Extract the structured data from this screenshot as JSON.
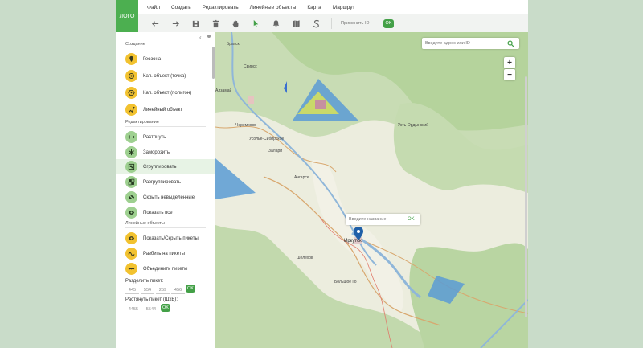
{
  "app": {
    "logo": "ЛОГО"
  },
  "menu": [
    "Файл",
    "Создать",
    "Редактировать",
    "Линейные объекты",
    "Карта",
    "Маршрут"
  ],
  "toolbar": {
    "icons": [
      "arrow-left-icon",
      "arrow-right-icon",
      "save-icon",
      "trash-icon",
      "hand-icon",
      "cursor-icon",
      "bell-icon",
      "map-icon",
      "s-curve-icon"
    ],
    "apply_placeholder": "Применить ID",
    "ok_label": "OK"
  },
  "sidebar": {
    "section_create": "Создание",
    "create_items": [
      {
        "label": "Геозона",
        "icon": "pin-icon"
      },
      {
        "label": "Кап. объект (точка)",
        "icon": "point-object-icon"
      },
      {
        "label": "Кап. объект (полигон)",
        "icon": "polygon-object-icon"
      },
      {
        "label": "Линейный объект",
        "icon": "line-object-icon"
      }
    ],
    "section_edit": "Редактирование",
    "edit_items": [
      {
        "label": "Растянуть",
        "icon": "stretch-icon"
      },
      {
        "label": "Заморозить",
        "icon": "snowflake-icon"
      },
      {
        "label": "Сгруппировать",
        "icon": "group-icon"
      },
      {
        "label": "Разгруппировать",
        "icon": "ungroup-icon"
      },
      {
        "label": "Скрыть невыделенные",
        "icon": "eye-off-icon"
      },
      {
        "label": "Показать все",
        "icon": "eye-icon"
      }
    ],
    "section_linear": "Линейные объекты",
    "linear_items": [
      {
        "label": "Показать/Скрыть пикеты",
        "icon": "eye-pickets-icon"
      },
      {
        "label": "Разбить на пикеты",
        "icon": "split-pickets-icon"
      },
      {
        "label": "Объединить пикеты",
        "icon": "merge-pickets-icon"
      }
    ],
    "split_label": "Разделить пикет:",
    "split_values": [
      "445",
      "554",
      "259",
      "456"
    ],
    "stretch_label": "Растянуть пикет (ШхВ):",
    "stretch_values": [
      "4455",
      "5544"
    ],
    "ok_label": "OK"
  },
  "map": {
    "search_placeholder": "Введите адрес или ID",
    "zoom_in": "+",
    "zoom_out": "−",
    "name_placeholder": "Введите название",
    "name_ok": "OK",
    "cities": [
      {
        "name": "Братск",
        "big": false
      },
      {
        "name": "Усть-Ордынский",
        "big": false
      },
      {
        "name": "Свирск",
        "big": false
      },
      {
        "name": "Черемхово",
        "big": false
      },
      {
        "name": "Ангарск",
        "big": false
      },
      {
        "name": "Иркутск",
        "big": true
      },
      {
        "name": "Шелехов",
        "big": false
      },
      {
        "name": "Алзамай",
        "big": false
      },
      {
        "name": "Залари",
        "big": false
      },
      {
        "name": "Усолье-Сибирское",
        "big": false
      },
      {
        "name": "Большое Го",
        "big": false
      }
    ]
  },
  "colors": {
    "accent": "#43a047",
    "highlight": "#e7f3e5",
    "yellow_icon": "#f2c230",
    "green_icon": "#9ed090"
  }
}
